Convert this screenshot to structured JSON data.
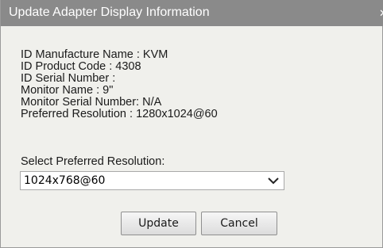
{
  "dialog": {
    "title": "Update Adapter Display Information",
    "close_glyph": "✕"
  },
  "info": {
    "manufacture_name": "ID Manufacture Name : KVM",
    "product_code": "ID Product Code : 4308",
    "serial_number": "ID Serial Number :",
    "monitor_name": "Monitor Name : 9\"",
    "monitor_serial": "Monitor Serial Number: N/A",
    "preferred_resolution": "Preferred Resolution : 1280x1024@60"
  },
  "resolution_select": {
    "label": "Select Preferred Resolution:",
    "selected_value": "1024x768@60"
  },
  "buttons": {
    "update_label": "Update",
    "cancel_label": "Cancel"
  }
}
